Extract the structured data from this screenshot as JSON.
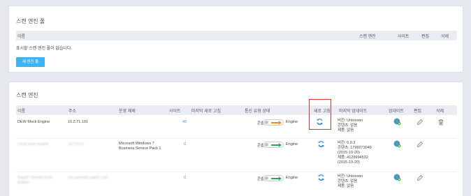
{
  "pools": {
    "title": "스캔 엔진 풀",
    "columns": [
      "이름",
      "스캔 엔진",
      "사이트",
      "편집",
      "삭제"
    ],
    "empty_text": "표시할 스캔 엔진 풀이 없습니다.",
    "new_button": "새 엔진 풀"
  },
  "engines": {
    "title": "스캔 엔진",
    "columns": [
      "이름",
      "주소",
      "운영 체제",
      "사이트",
      "마지막 새로 고침",
      "통신 유형 상태",
      "새로 고침",
      "마지막 업데이트",
      "업데이트",
      "편집",
      "삭제"
    ],
    "rows": [
      {
        "name": "DEW Mock Engine",
        "address": "10.2.71.191",
        "os": "",
        "sites": "40",
        "toggle_label": "콘솔",
        "toggle_target": "Engine",
        "toggle_arrow": "orange",
        "update": "버전: Unknown\n콘텐츠: 없음\n제품: 없음",
        "deletable": true,
        "blurred": false
      },
      {
        "name": "Local scan engine",
        "address": "127.0.0.1",
        "os": "Microsoft Windows 7\nBusiness Service Pack 1",
        "sites": "0",
        "toggle_label": "콘솔",
        "toggle_target": "Engine",
        "toggle_arrow": "green",
        "update": "버전: 6.0.3\n콘텐츠: 1799273049\n(2015-10-20)\n제품: 4129994532\n(2015-10-20)",
        "deletable": false,
        "blurred": true
      },
      {
        "name": "Rapid7 Hosted Scan\nEngine",
        "address": "rsa.extranet.rapid7.com",
        "os": "",
        "sites": "0",
        "toggle_label": "콘솔",
        "toggle_target": "Engine",
        "toggle_arrow": "green",
        "update": "버전: Unknown\n콘텐츠: 없음\n제품: 없음",
        "deletable": false,
        "blurred": true
      }
    ]
  },
  "icons": {
    "refresh": "refresh-icon",
    "update": "globe-update-icon",
    "edit": "pencil-icon",
    "delete": "trash-icon"
  },
  "colors": {
    "accent": "#3fb3ef",
    "highlight": "#d2322d",
    "orange_arrow": "#f08a24",
    "green_arrow": "#2ea84f"
  }
}
